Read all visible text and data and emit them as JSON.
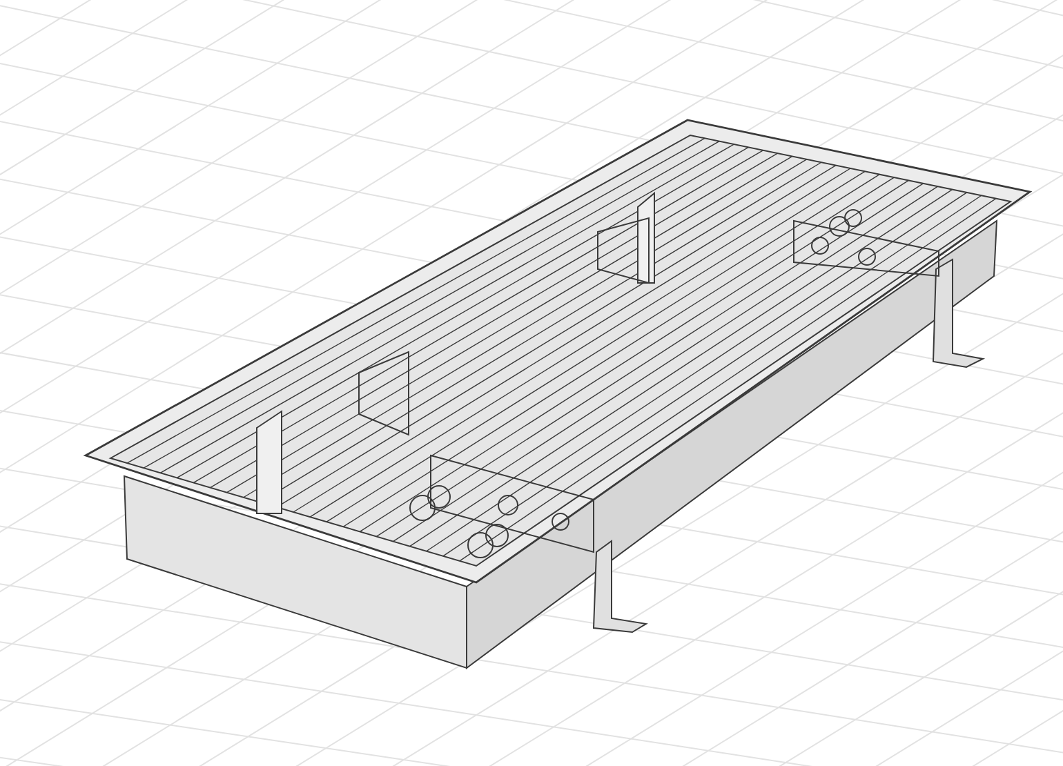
{
  "scene": {
    "grid": true
  }
}
